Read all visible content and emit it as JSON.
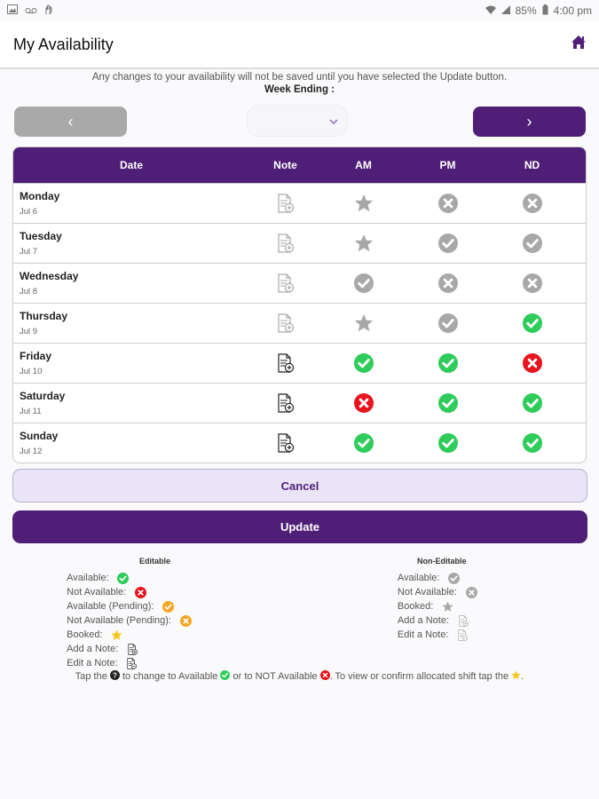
{
  "status_bar": {
    "battery": "85%",
    "time": "4:00 pm"
  },
  "app_bar": {
    "title": "My Availability"
  },
  "notice": "Any changes to your availability will not be saved until you have selected the Update button.",
  "week_ending_label": "Week Ending :",
  "week_select_value": "",
  "nav": {
    "prev": "‹",
    "next": "›"
  },
  "table": {
    "headers": {
      "date": "Date",
      "note": "Note",
      "am": "AM",
      "pm": "PM",
      "nd": "ND"
    },
    "rows": [
      {
        "day": "Monday",
        "date": "Jul 6",
        "note": "add-note-grey",
        "am": "booked-grey",
        "pm": "not-available-grey",
        "nd": "not-available-grey"
      },
      {
        "day": "Tuesday",
        "date": "Jul 7",
        "note": "add-note-grey",
        "am": "booked-grey",
        "pm": "available-grey",
        "nd": "available-grey"
      },
      {
        "day": "Wednesday",
        "date": "Jul 8",
        "note": "add-note-grey",
        "am": "available-grey",
        "pm": "not-available-grey",
        "nd": "not-available-grey"
      },
      {
        "day": "Thursday",
        "date": "Jul 9",
        "note": "add-note-grey",
        "am": "booked-grey",
        "pm": "available-grey",
        "nd": "available-green"
      },
      {
        "day": "Friday",
        "date": "Jul 10",
        "note": "add-note-black",
        "am": "available-green",
        "pm": "available-green",
        "nd": "not-available-red"
      },
      {
        "day": "Saturday",
        "date": "Jul 11",
        "note": "add-note-black",
        "am": "not-available-red",
        "pm": "available-green",
        "nd": "available-green"
      },
      {
        "day": "Sunday",
        "date": "Jul 12",
        "note": "add-note-black",
        "am": "available-green",
        "pm": "available-green",
        "nd": "available-green"
      }
    ]
  },
  "buttons": {
    "cancel": "Cancel",
    "update": "Update"
  },
  "legend": {
    "editable_title": "Editable",
    "editable": [
      {
        "label": "Available:",
        "icon": "available-green"
      },
      {
        "label": "Not Available:",
        "icon": "not-available-red"
      },
      {
        "label": "Available (Pending):",
        "icon": "available-orange"
      },
      {
        "label": "Not Available (Pending):",
        "icon": "not-available-orange"
      },
      {
        "label": "Booked:",
        "icon": "booked-yellow"
      },
      {
        "label": "Add a Note:",
        "icon": "add-note-black"
      },
      {
        "label": "Edit a Note:",
        "icon": "edit-note-black"
      }
    ],
    "noneditable_title": "Non-Editable",
    "noneditable": [
      {
        "label": "Available:",
        "icon": "available-grey"
      },
      {
        "label": "Not Available:",
        "icon": "not-available-grey"
      },
      {
        "label": "Booked:",
        "icon": "booked-grey"
      },
      {
        "label": "Add a Note:",
        "icon": "add-note-grey"
      },
      {
        "label": "Edit a Note:",
        "icon": "edit-note-grey"
      }
    ]
  },
  "tap_hint": {
    "part1": "Tap the",
    "part2": "to change to Available",
    "part3": "or to NOT Available",
    "part4": ". To view or confirm allocated shift tap the",
    "part5": "."
  },
  "colors": {
    "primary": "#4f1f78",
    "green": "#2ecc5a",
    "red": "#e8141e",
    "grey": "#a8a8a8",
    "orange": "#f5a623",
    "yellow": "#f5c518"
  }
}
